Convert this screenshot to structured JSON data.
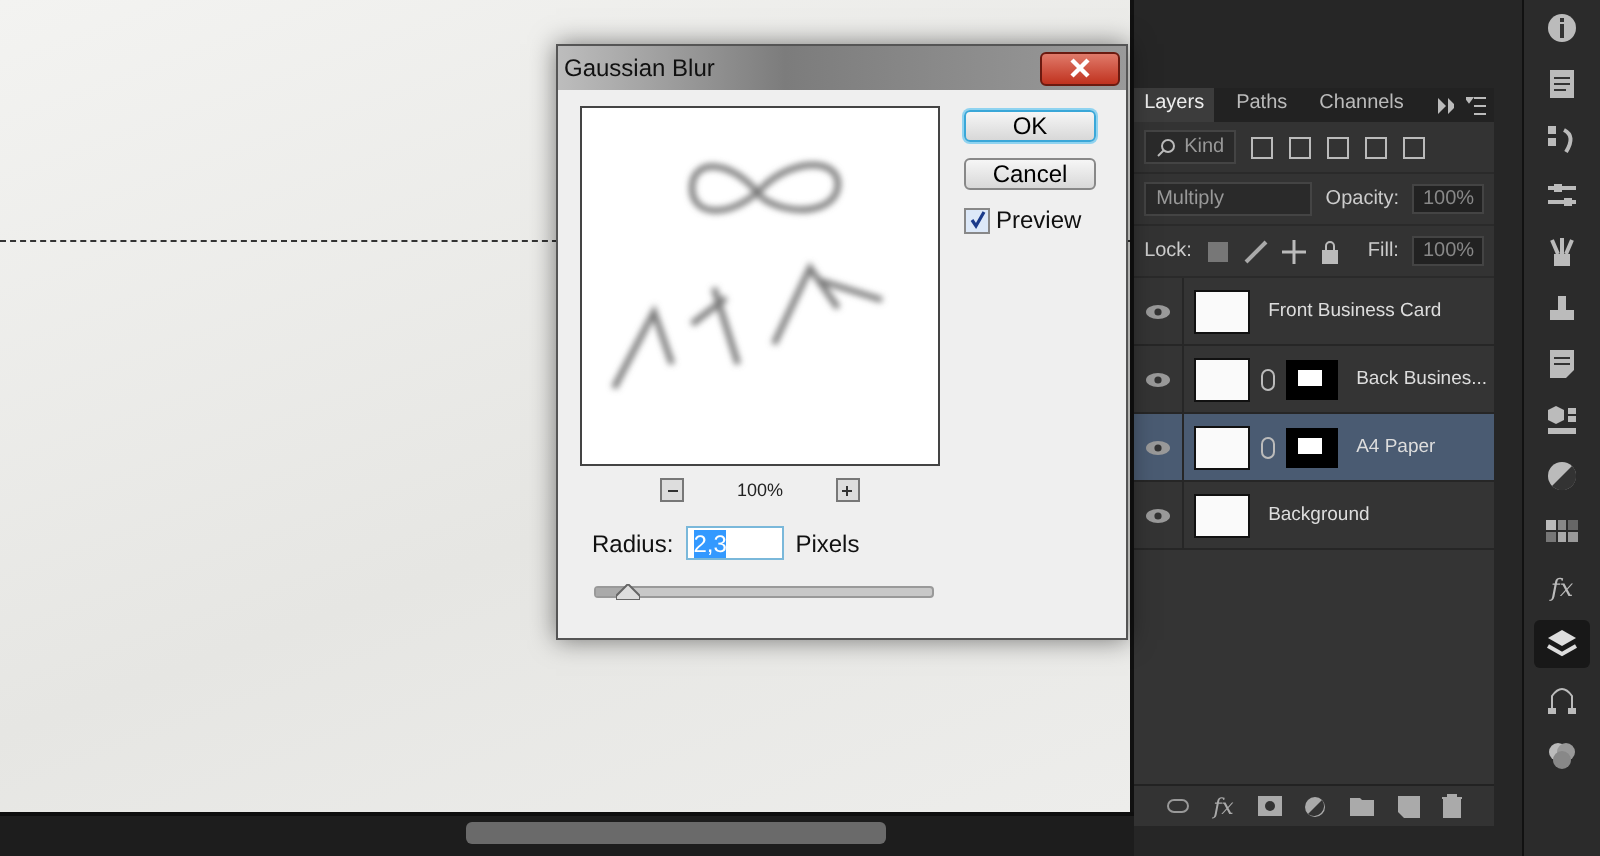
{
  "dialog": {
    "title": "Gaussian Blur",
    "zoom": "100%",
    "buttons": [
      {
        "label": "OK",
        "kind": "default"
      },
      {
        "label": "Cancel",
        "kind": "normal"
      }
    ],
    "preview": {
      "label": "Preview",
      "checked": true
    },
    "radius": {
      "label": "Radius:",
      "value": "2,3",
      "unit": "Pixels",
      "level": 0.1
    }
  },
  "layers_panel": {
    "tabs": [
      {
        "label": "Layers",
        "selected": true
      },
      {
        "label": "Paths",
        "selected": false
      },
      {
        "label": "Channels",
        "selected": false
      }
    ],
    "filter": "Kind",
    "blend_mode": "Multiply",
    "opacity_label": "Opacity:",
    "opacity": "100%",
    "lock_label": "Lock:",
    "fill_label": "Fill:",
    "fill": "100%",
    "layers": [
      {
        "name": "Front Business Card",
        "kind": "smart",
        "selected": false,
        "visible": true
      },
      {
        "name": "Back Busines...",
        "kind": "masked",
        "selected": false,
        "visible": true
      },
      {
        "name": "A4 Paper",
        "kind": "masked",
        "selected": true,
        "visible": true
      },
      {
        "name": "Background",
        "kind": "plain",
        "selected": false,
        "visible": true
      }
    ],
    "fx_label": "fx"
  },
  "toolbar": [
    {
      "kind": "info",
      "selected": false
    },
    {
      "kind": "document",
      "selected": false
    },
    {
      "kind": "history",
      "selected": false
    },
    {
      "kind": "sliders",
      "selected": false
    },
    {
      "kind": "brushes",
      "selected": false
    },
    {
      "kind": "stamp",
      "selected": false
    },
    {
      "kind": "notes",
      "selected": false
    },
    {
      "kind": "cube",
      "selected": false
    },
    {
      "kind": "adjust",
      "selected": false
    },
    {
      "kind": "swatches",
      "selected": false
    },
    {
      "kind": "styles",
      "selected": false,
      "label": "fx"
    },
    {
      "kind": "layers",
      "selected": true
    },
    {
      "kind": "paths",
      "selected": false
    },
    {
      "kind": "channels",
      "selected": false
    }
  ]
}
